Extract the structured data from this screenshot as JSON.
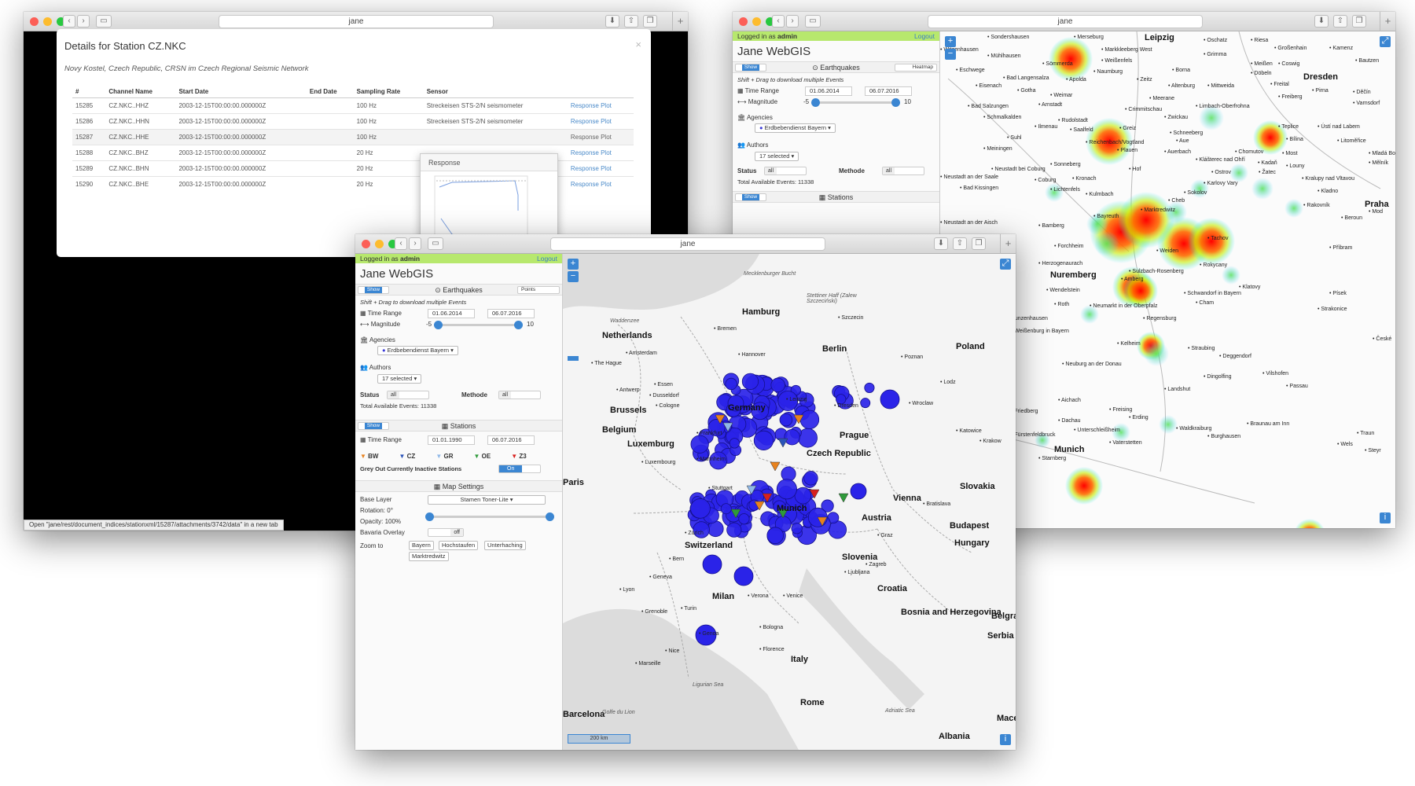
{
  "browser": {
    "address": "jane"
  },
  "details": {
    "title": "Details for Station CZ.NKC",
    "close": "×",
    "subtitle": "Novy Kostel, Czech Republic, CRSN im Czech Regional Seismic Network",
    "columns": [
      "#",
      "Channel Name",
      "Start Date",
      "End Date",
      "Sampling Rate",
      "Sensor"
    ],
    "rows": [
      {
        "id": "15285",
        "channel": "CZ.NKC..HHZ",
        "start": "2003-12-15T00:00:00.000000Z",
        "end": "",
        "rate": "100 Hz",
        "sensor": "Streckeisen STS-2/N seismometer",
        "link": "Response Plot"
      },
      {
        "id": "15286",
        "channel": "CZ.NKC..HHN",
        "start": "2003-12-15T00:00:00.000000Z",
        "end": "",
        "rate": "100 Hz",
        "sensor": "Streckeisen STS-2/N seismometer",
        "link": "Response Plot"
      },
      {
        "id": "15287",
        "channel": "CZ.NKC..HHE",
        "start": "2003-12-15T00:00:00.000000Z",
        "end": "",
        "rate": "100 Hz",
        "sensor": "",
        "link": "Response Plot"
      },
      {
        "id": "15288",
        "channel": "CZ.NKC..BHZ",
        "start": "2003-12-15T00:00:00.000000Z",
        "end": "",
        "rate": "20 Hz",
        "sensor": "",
        "link": "Response Plot"
      },
      {
        "id": "15289",
        "channel": "CZ.NKC..BHN",
        "start": "2003-12-15T00:00:00.000000Z",
        "end": "",
        "rate": "20 Hz",
        "sensor": "",
        "link": "Response Plot"
      },
      {
        "id": "15290",
        "channel": "CZ.NKC..BHE",
        "start": "2003-12-15T00:00:00.000000Z",
        "end": "",
        "rate": "20 Hz",
        "sensor": "",
        "link": "Response Plot"
      }
    ],
    "response_title": "Response",
    "status_bar": "Open \"jane/rest/document_indices/stationxml/15287/attachments/3742/data\" in a new tab"
  },
  "app": {
    "logged_in_prefix": "Logged in as ",
    "user": "admin",
    "logout": "Logout",
    "title": "Jane WebGIS",
    "show": "Show",
    "earthquakes": {
      "header": "Earthquakes",
      "mode_front": "Points",
      "mode_back": "Heatmap",
      "hint": "Shift + Drag to download multiple Events",
      "time_range_label": "Time Range",
      "time_from": "01.06.2014",
      "time_to": "06.07.2016",
      "magnitude_label": "Magnitude",
      "mag_min": "-5",
      "mag_max": "10",
      "agencies_label": "Agencies",
      "agency_selected": "Erdbebendienst Bayern",
      "authors_label": "Authors",
      "authors_selected": "17 selected",
      "status_label": "Status",
      "status_value": "all",
      "methode_label": "Methode",
      "methode_value": "all",
      "total": "Total Available Events: 11338"
    },
    "stations": {
      "header": "Stations",
      "time_range_label": "Time Range",
      "time_from": "01.01.1990",
      "time_to": "06.07.2016",
      "legend": [
        {
          "code": "BW",
          "color": "#e8821e"
        },
        {
          "code": "CZ",
          "color": "#2a53b8"
        },
        {
          "code": "GR",
          "color": "#8fb8e8"
        },
        {
          "code": "OE",
          "color": "#2e9a3a"
        },
        {
          "code": "Z3",
          "color": "#d8201e"
        }
      ],
      "grey_out_label": "Grey Out Currently Inactive Stations",
      "grey_out_value": "On"
    },
    "map_settings": {
      "header": "Map Settings",
      "base_layer_label": "Base Layer",
      "base_layer_value": "Stamen Toner-Lite",
      "rotation_label": "Rotation: 0°",
      "opacity_label": "Opacity: 100%",
      "bavaria_label": "Bavaria Overlay",
      "bavaria_value": "off",
      "zoom_label": "Zoom to",
      "zoom_targets": [
        "Bayern",
        "Hochstaufen",
        "Unterhaching",
        "Marktredwitz"
      ]
    },
    "scale": "200 km",
    "info": "i"
  },
  "map_front": {
    "countries": [
      "Netherlands",
      "Belgium",
      "Luxemburg",
      "Germany",
      "Czech Republic",
      "Poland",
      "Slovakia",
      "Hungary",
      "Slovenia",
      "Croatia",
      "Bosnia and Herzegovina",
      "Italy",
      "Switzerland",
      "Austria",
      "Serbia"
    ],
    "cities": [
      "Hamburg",
      "Bremen",
      "Hannover",
      "Berlin",
      "Amsterdam",
      "The Hague",
      "Essen",
      "Dusseldorf",
      "Cologne",
      "Antwerp",
      "Brussels",
      "Luxembourg",
      "Paris",
      "Frankfurt",
      "Mannheim",
      "Stuttgart",
      "Munich",
      "Prague",
      "Vienna",
      "Bratislava",
      "Budapest",
      "Zurich",
      "Geneva",
      "Milan",
      "Turin",
      "Venice",
      "Verona",
      "Ljubljana",
      "Lyon",
      "Grenoble",
      "Nice",
      "Marseille",
      "Genoa",
      "Florence",
      "Rome",
      "Barcelona",
      "Dresden",
      "Leipzig",
      "Poznan",
      "Wroclaw",
      "Katowice",
      "Krakow",
      "Lodz",
      "Szczecin",
      "Graz",
      "Bern",
      "Bologna",
      "Zagreb",
      "Albania",
      "Mace",
      "Belgra"
    ],
    "seas": [
      "Waddenzee",
      "Mecklenburger Bucht",
      "Stettiner Haff (Zalew Szczeciński)",
      "Ligurian Sea",
      "Golfe du Lion",
      "Adriatic Sea"
    ]
  },
  "map_back": {
    "cities": [
      "Sondershausen",
      "Merseburg",
      "Leipzig",
      "Oschatz",
      "Riesa",
      "Großenhain",
      "Kamenz",
      "Bautzen",
      "Witzenhausen",
      "Mühlhausen",
      "Sömmerda",
      "Markkleeberg West",
      "Weißenfels",
      "Grimma",
      "Meißen",
      "Coswig",
      "Dresden",
      "Eschwege",
      "Bad Langensalza",
      "Naumburg",
      "Borna",
      "Döbeln",
      "Pirna",
      "Eisenach",
      "Gotha",
      "Apolda",
      "Zeitz",
      "Altenburg",
      "Mittweida",
      "Freital",
      "Děčín",
      "Weimar",
      "Meerane",
      "Limbach-Oberfrohna",
      "Freiberg",
      "Varnsdorf",
      "Bad Salzungen",
      "Arnstadt",
      "Crimmitschau",
      "Schmalkalden",
      "Rudolstadt",
      "Zwickau",
      "Ilmenau",
      "Saalfeld",
      "Greiz",
      "Schneeberg",
      "Teplice",
      "Ústí nad Labem",
      "Suhl",
      "Reichenbach/Vogtland",
      "Aue",
      "Bílina",
      "Litoměřice",
      "Meiningen",
      "Plauen",
      "Auerbach",
      "Chomutov",
      "Most",
      "Mladá Bole",
      "Neustadt bei Coburg",
      "Sonneberg",
      "Klášterec nad Ohří",
      "Mělník",
      "Neustadt an der Saale",
      "Coburg",
      "Kronach",
      "Hof",
      "Ostrov",
      "Kadaň",
      "Louny",
      "Bad Kissingen",
      "Lichtenfels",
      "Kulmbach",
      "Karlovy Vary",
      "Žatec",
      "Kralupy nad Vltavou",
      "Bayreuth",
      "Marktredwitz",
      "Cheb",
      "Sokolov",
      "Kladno",
      "Praha",
      "Rakovník",
      "Beroun",
      "Mod",
      "Bamberg",
      "Forchheim",
      "Weiden",
      "Příbram",
      "Herzogenaurach",
      "Nuremberg",
      "Amberg",
      "Rokycany",
      "Wendelstein",
      "Klatovy",
      "Písek",
      "Roth",
      "Neumarkt in der Oberpfalz",
      "Cham",
      "Strakonice",
      "Gunzenhausen",
      "Weißenburg in Bayern",
      "Regensburg",
      "Kelheim",
      "Straubing",
      "Deggendorf",
      "Neuburg an der Donau",
      "Dingolfing",
      "Vilshofen",
      "Passau",
      "Landshut",
      "Aichach",
      "Freising",
      "Dachau",
      "Erding",
      "Unterschleißheim",
      "Waldkraiburg",
      "Braunau am Inn",
      "Burghausen",
      "Traun",
      "Wels",
      "Vaterstetten",
      "Munich",
      "Starnberg",
      "Fürstenfeldbruck",
      "Friedberg",
      "Ingolstadt",
      "Neustadt an der Aisch",
      "Erlangen",
      "Schwabach",
      "Schwandorf in Bayern",
      "Sulzbach-Rosenberg",
      "Tachov",
      "České",
      "Steyr"
    ]
  }
}
